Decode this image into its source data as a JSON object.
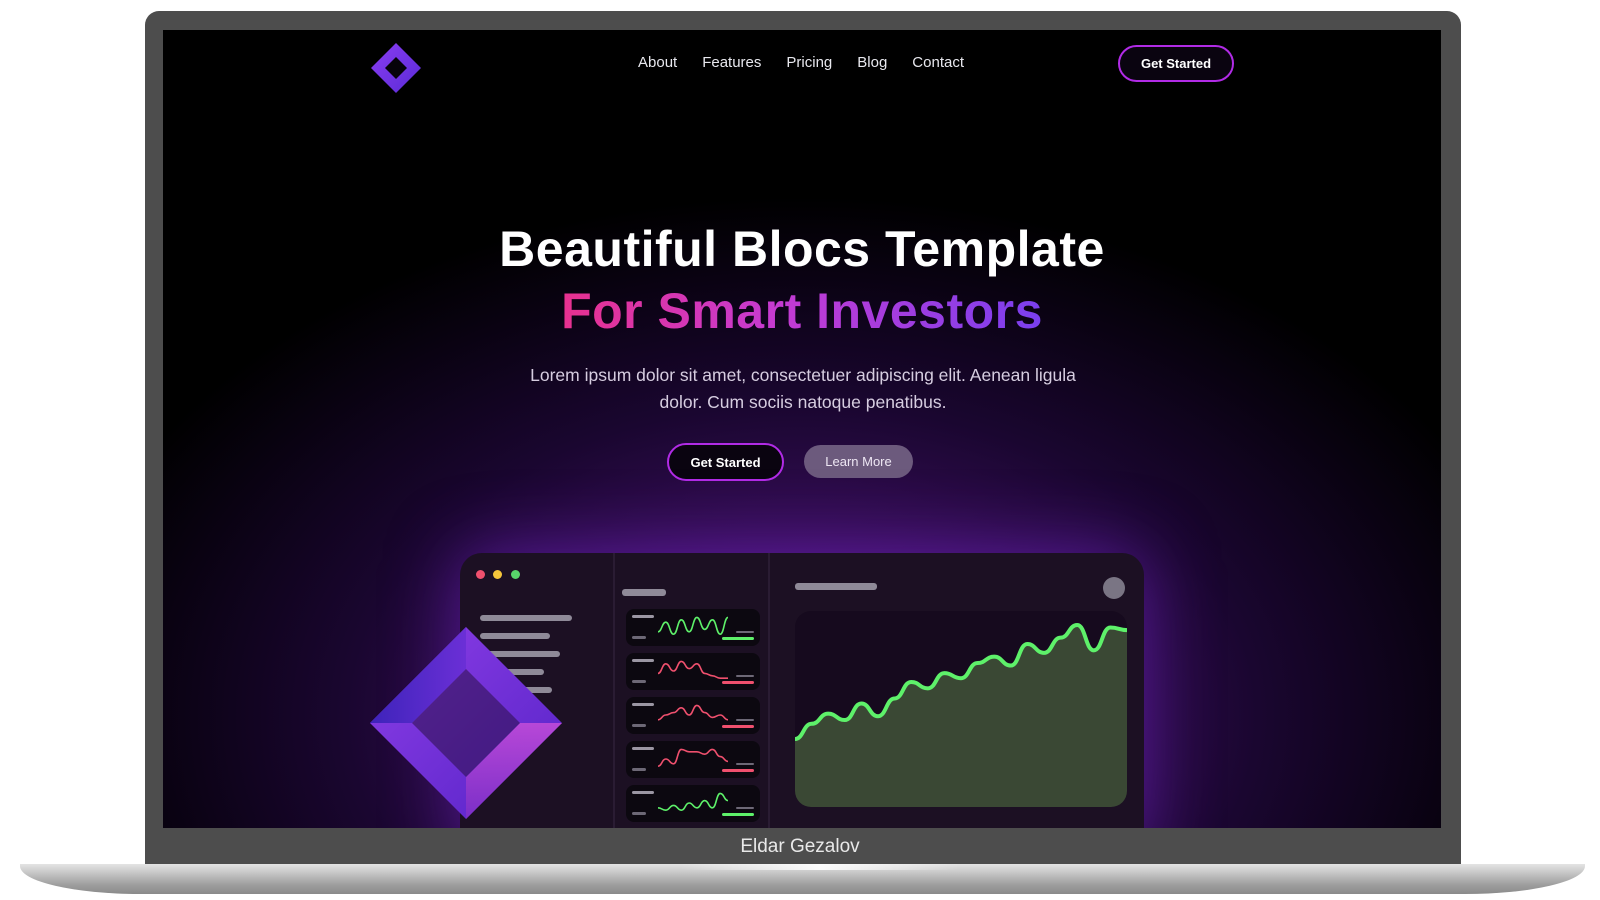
{
  "nav": {
    "links": [
      "About",
      "Features",
      "Pricing",
      "Blog",
      "Contact"
    ],
    "cta_label": "Get Started"
  },
  "hero": {
    "title": "Beautiful Blocs Template",
    "subtitle": "For Smart Investors",
    "description": "Lorem ipsum dolor sit amet, consectetuer adipiscing elit. Aenean ligula dolor. Cum sociis natoque penatibus.",
    "primary_cta": "Get Started",
    "secondary_cta": "Learn More"
  },
  "laptop": {
    "label": "Eldar Gezalov"
  },
  "colors": {
    "accent_purple": "#b12be6",
    "gradient_pink": "#e8318f",
    "gradient_violet": "#7a3fef",
    "chart_green": "#5ef16a",
    "chart_red": "#f0506e",
    "window_dots": [
      "#f0506e",
      "#f5c53b",
      "#58d36a"
    ]
  },
  "icons": {
    "logo": "diamond-logo-icon",
    "decoration": "diamond-decoration-icon"
  },
  "dashboard": {
    "mini_charts": [
      {
        "trend": "up",
        "color": "green",
        "values": [
          3,
          7,
          2,
          8,
          3,
          9,
          4,
          8,
          2,
          9
        ]
      },
      {
        "trend": "down",
        "color": "red",
        "values": [
          4,
          8,
          5,
          9,
          6,
          8,
          4,
          3,
          2,
          2
        ]
      },
      {
        "trend": "down",
        "color": "red",
        "values": [
          3,
          5,
          6,
          8,
          5,
          9,
          6,
          4,
          5,
          3
        ]
      },
      {
        "trend": "down",
        "color": "red",
        "values": [
          2,
          5,
          3,
          9,
          8,
          8,
          7,
          9,
          6,
          4
        ]
      },
      {
        "trend": "up",
        "color": "green",
        "values": [
          3,
          2,
          4,
          2,
          5,
          3,
          6,
          3,
          9,
          6
        ]
      }
    ],
    "main_chart": {
      "trend": "up",
      "values": [
        10,
        22,
        30,
        25,
        38,
        28,
        42,
        55,
        50,
        62,
        58,
        70,
        75,
        68,
        85,
        78,
        90,
        100,
        80,
        98,
        96
      ]
    }
  }
}
